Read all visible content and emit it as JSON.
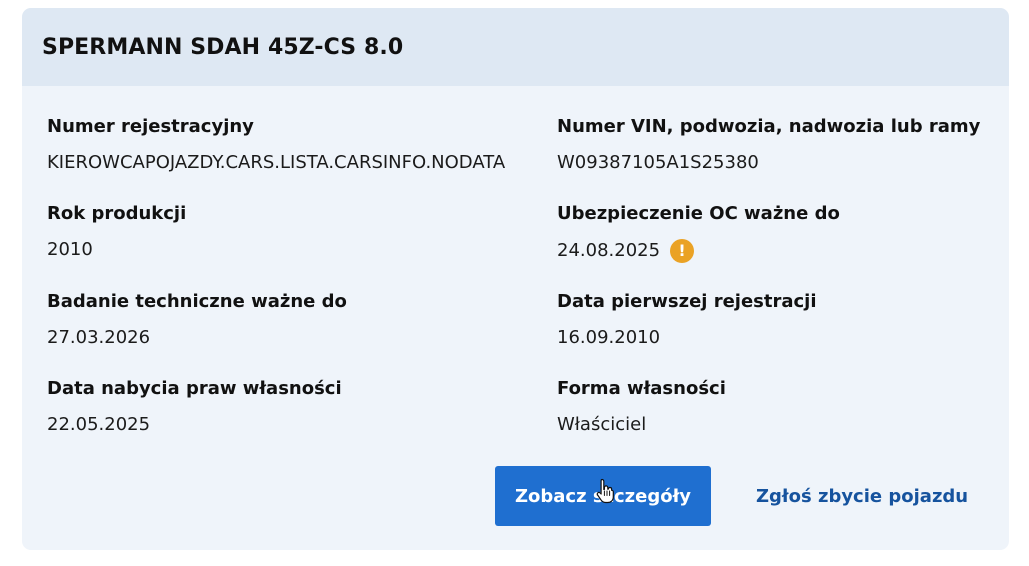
{
  "vehicle": {
    "title": "SPERMANN SDAH 45Z-CS 8.0"
  },
  "fields": {
    "registration": {
      "label": "Numer rejestracyjny",
      "value": "KIEROWCAPOJAZDY.CARS.LISTA.CARSINFO.NODATA"
    },
    "vin": {
      "label": "Numer VIN, podwozia, nadwozia lub ramy",
      "value": "W09387105A1S25380"
    },
    "production_year": {
      "label": "Rok produkcji",
      "value": "2010"
    },
    "oc_insurance": {
      "label": "Ubezpieczenie OC ważne do",
      "value": "24.08.2025",
      "warning_icon": "exclamation-circle-icon",
      "warning_color": "#eaa225"
    },
    "technical_inspection": {
      "label": "Badanie techniczne ważne do",
      "value": "27.03.2026"
    },
    "first_registration": {
      "label": "Data pierwszej rejestracji",
      "value": "16.09.2010"
    },
    "ownership_acquired": {
      "label": "Data nabycia praw własności",
      "value": "22.05.2025"
    },
    "ownership_form": {
      "label": "Forma własności",
      "value": "Właściciel"
    }
  },
  "actions": {
    "details_label": "Zobacz szczegóły",
    "report_sale_label": "Zgłoś zbycie pojazdu"
  },
  "colors": {
    "primary": "#1f6fd0",
    "link": "#16539e",
    "card_bg": "#eff4fa",
    "header_bg": "#dee8f3",
    "warning": "#eaa225"
  }
}
